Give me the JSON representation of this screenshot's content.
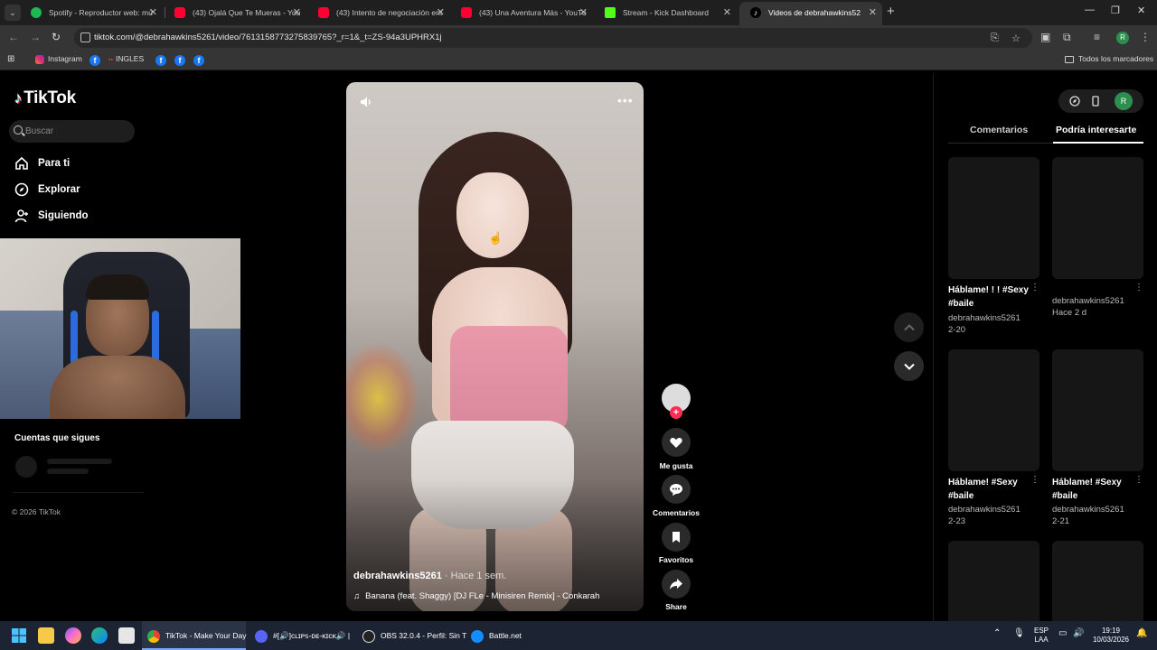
{
  "browser": {
    "tabs": [
      {
        "label": "Spotify - Reproductor web: mú",
        "favicon_color": "#1db954"
      },
      {
        "label": "(43) Ojalá Que Te Mueras - You",
        "favicon_color": "#ff0033"
      },
      {
        "label": "(43) Intento de negociación ent",
        "favicon_color": "#ff0033"
      },
      {
        "label": "(43) Una Aventura Más - YouTu",
        "favicon_color": "#ff0033"
      },
      {
        "label": "Stream - Kick Dashboard",
        "favicon_color": "#53fc18"
      },
      {
        "label": "Videos de debrahawkins52",
        "favicon_color": "#000000"
      }
    ],
    "new_tab_label": "+",
    "url": "tiktok.com/@debrahawkins5261/video/7613158773275839765?_r=1&_t=ZS-94a3UPHRX1j",
    "profile_initial": "R",
    "bookmarks": {
      "instagram": "Instagram",
      "ingles": "INGLES",
      "all_bookmarks": "Todos los marcadores"
    }
  },
  "tiktok": {
    "logo": "TikTok",
    "search_placeholder": "Buscar",
    "nav": {
      "for_you": "Para ti",
      "explore": "Explorar",
      "following": "Siguiendo"
    },
    "following_heading": "Cuentas que sigues",
    "copyright": "© 2026 TikTok",
    "video": {
      "author": "debrahawkins5261",
      "age": "· Hace 1 sem.",
      "music": "Banana (feat. Shaggy) [DJ FLe - Minisiren Remix] - Conkarah"
    },
    "actions": {
      "like": "Me gusta",
      "comments": "Comentarios",
      "favorites": "Favoritos",
      "share": "Share"
    },
    "panel": {
      "tab_comments": "Comentarios",
      "tab_suggested": "Podría interesarte",
      "profile_initial": "R",
      "cards": [
        {
          "title": "Háblame! ! ! #Sexy #baile",
          "author": "debrahawkins5261",
          "date": "2-20"
        },
        {
          "title": "",
          "author": "debrahawkins5261",
          "date": "Hace 2 d"
        },
        {
          "title": "Háblame! #Sexy #baile",
          "author": "debrahawkins5261",
          "date": "2-23"
        },
        {
          "title": "Háblame! #Sexy #baile",
          "author": "debrahawkins5261",
          "date": "2-21"
        }
      ]
    }
  },
  "taskbar": {
    "apps": {
      "chrome": "TikTok - Make Your Day",
      "discord": "#[🔊]ᴄʟɪᴘꜱ-ᴅᴇ-ᴋɪᴄᴋ🔊 |",
      "obs": "OBS 32.0.4 - Perfil: Sin T",
      "battlenet": "Battle.net"
    },
    "lang_top": "ESP",
    "lang_bottom": "LAA",
    "time": "19:19",
    "date": "10/03/2026"
  }
}
